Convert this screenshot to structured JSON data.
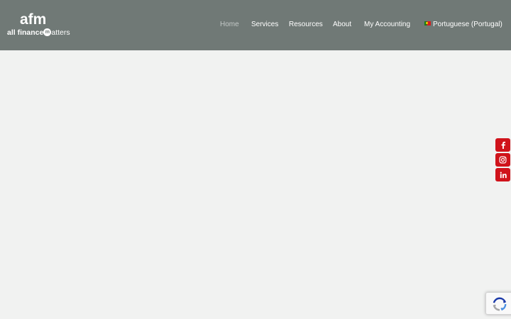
{
  "logo": {
    "mark": "afm",
    "tagline_pre": "all finance",
    "tagline_m": "m",
    "tagline_post": "atters"
  },
  "nav": {
    "items": [
      {
        "label": "Home",
        "active": true
      },
      {
        "label": "Services"
      },
      {
        "label": "Resources"
      },
      {
        "label": "About"
      },
      {
        "label": "My Accounting"
      }
    ],
    "language": "Portuguese (Portugal)"
  },
  "social": [
    "facebook-icon",
    "instagram-icon",
    "linkedin-icon"
  ],
  "colors": {
    "header_bg": "#707976",
    "page_bg": "#f1f2f1",
    "social_red": "#d0131b"
  }
}
